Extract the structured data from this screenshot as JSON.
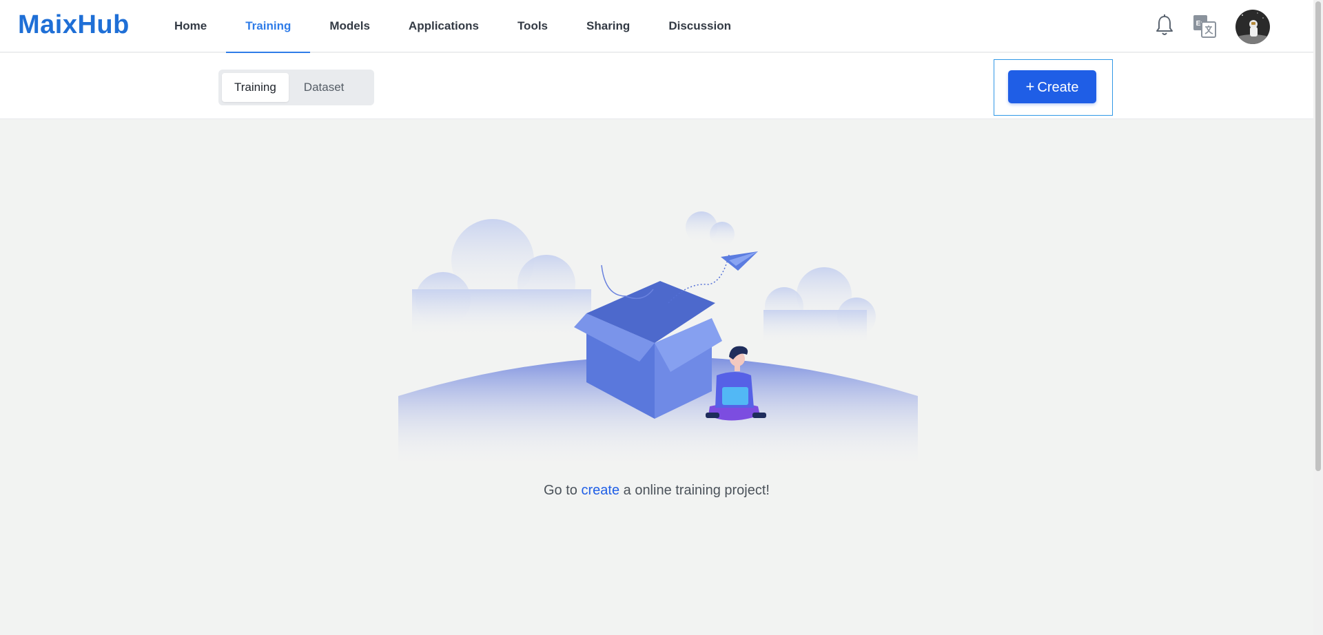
{
  "header": {
    "logo": "MaixHub",
    "nav": [
      {
        "label": "Home",
        "active": false
      },
      {
        "label": "Training",
        "active": true
      },
      {
        "label": "Models",
        "active": false
      },
      {
        "label": "Applications",
        "active": false
      },
      {
        "label": "Tools",
        "active": false
      },
      {
        "label": "Sharing",
        "active": false
      },
      {
        "label": "Discussion",
        "active": false
      }
    ],
    "icons": [
      "bell-icon",
      "language-icon",
      "avatar"
    ],
    "lang_badge": "En"
  },
  "subbar": {
    "tabs": [
      {
        "label": "Training",
        "active": true
      },
      {
        "label": "Dataset",
        "active": false
      }
    ],
    "create_label": "Create"
  },
  "empty": {
    "prefix": "Go to ",
    "link": "create",
    "suffix": " a online training project!"
  },
  "colors": {
    "accent": "#2f7ce8",
    "primary_button": "#1f5ee6",
    "background": "#f2f3f2"
  }
}
